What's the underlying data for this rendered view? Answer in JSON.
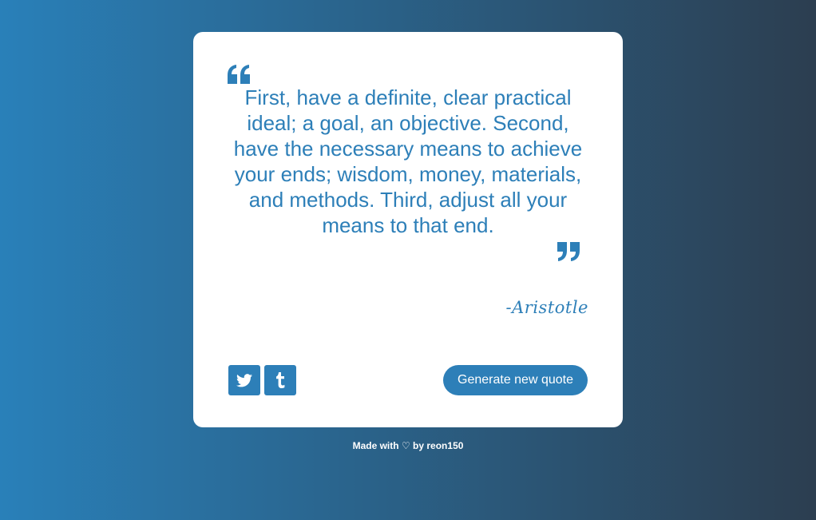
{
  "quote": {
    "text": "First, have a definite, clear practical ideal; a goal, an objective. Second, have the necessary means to achieve your ends; wisdom, money, materials, and methods. Third, adjust all your means to that end.",
    "author": "-Aristotle"
  },
  "actions": {
    "generate_label": "Generate new quote",
    "twitter_icon": "twitter-icon",
    "tumblr_icon": "tumblr-icon"
  },
  "footer": {
    "prefix": "Made with",
    "heart": "♡",
    "suffix": "by reon150"
  },
  "colors": {
    "accent": "#2d7fb8",
    "gradient_start": "#2980b9",
    "gradient_end": "#2c3e50"
  }
}
